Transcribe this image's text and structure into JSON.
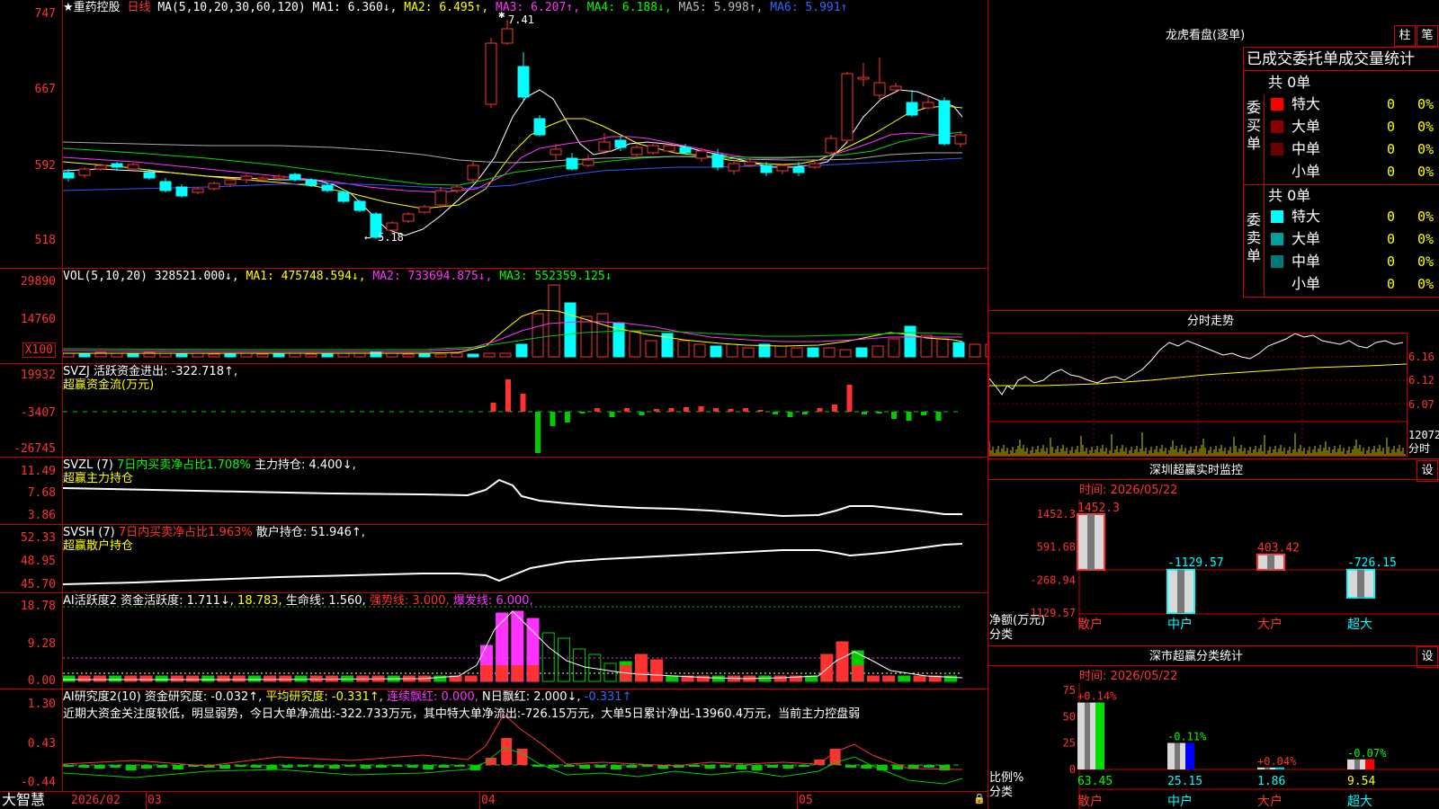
{
  "app": {
    "brand": "大智慧",
    "stock_name": "★重药控股",
    "period": "日线"
  },
  "colors": {
    "up": "#ff3232",
    "down": "#00ffff",
    "bg": "#000000",
    "frame": "#c00000"
  },
  "kline": {
    "ma_label": "MA(5,10,20,30,60,120)",
    "ma1": "MA1: 6.360↓,",
    "ma2": "MA2: 6.495↑,",
    "ma3": "MA3: 6.207↑,",
    "ma4": "MA4: 6.188↓,",
    "ma5": "MA5: 5.998↑,",
    "ma6": "MA6: 5.991↑",
    "yticks": [
      "747",
      "667",
      "592",
      "518"
    ],
    "high_mark": "7.41",
    "low_mark": "5.18"
  },
  "vol": {
    "label": "VOL(5,10,20)",
    "value": "328521.000↓,",
    "ma1": "MA1: 475748.594↓,",
    "ma2": "MA2: 733694.875↓,",
    "ma3": "MA3: 552359.125↓",
    "yticks": [
      "29890",
      "14760"
    ],
    "unit": "X100"
  },
  "svzj": {
    "label": "SVZJ  活跃资金进出: -322.718↑,",
    "subtitle": "超赢资金流(万元)",
    "yticks": [
      "19932",
      "-3407",
      "-26745"
    ]
  },
  "svzl": {
    "label": "SVZL (7)",
    "ratio": "7日内买卖净占比1.708%",
    "pos": "主力持仓: 4.400↓,",
    "subtitle": "超赢主力持仓",
    "yticks": [
      "11.49",
      "7.68",
      "3.86"
    ]
  },
  "svsh": {
    "label": "SVSH (7)",
    "ratio": "7日内买卖净占比1.963%",
    "pos": "散户持仓: 51.946↑,",
    "subtitle": "超赢散户持仓",
    "yticks": [
      "52.33",
      "48.95",
      "45.70"
    ]
  },
  "ai1": {
    "label": "AI活跃度2",
    "a": "资金活跃度: 1.711↓,",
    "b": "18.783,",
    "c": "生命线: 1.560,",
    "d": "强势线: 3.000,",
    "e": "爆发线: 6.000,",
    "yticks": [
      "18.78",
      "9.28",
      "0.00"
    ]
  },
  "ai2": {
    "label": "AI研究度2(10)",
    "a": "资金研究度: -0.032↑,",
    "b": "平均研究度: -0.331↑,",
    "c": "连续飘红: 0.000,",
    "d": "N日飘红: 2.000↓,",
    "e": "-0.331↑",
    "text": "近期大资金关注度较低，明显弱势，今日大单净流出:-322.733万元，其中特大单净流出:-726.15万元，大单5日累计净出-13960.4万元，当前主力控盘弱",
    "yticks": [
      "1.30",
      "0.43",
      "-0.44"
    ]
  },
  "xaxis": {
    "labels": [
      "2026/02",
      "03",
      "04",
      "05"
    ]
  },
  "lhb": {
    "title": "龙虎看盘(逐单)",
    "btn1": "柱",
    "btn2": "笔",
    "header": "已成交委托单成交量统计",
    "buy_label": "委买单",
    "sell_label": "委卖单",
    "buy_total": "共 0单",
    "sell_total": "共 0单",
    "buy_rows": [
      {
        "name": "特大",
        "count": "0",
        "pct": "0%",
        "color": "#ff0000"
      },
      {
        "name": "大单",
        "count": "0",
        "pct": "0%",
        "color": "#8b0000"
      },
      {
        "name": "中单",
        "count": "0",
        "pct": "0%",
        "color": "#6e0000"
      },
      {
        "name": "小单",
        "count": "0",
        "pct": "0%",
        "color": "#000000"
      }
    ],
    "sell_rows": [
      {
        "name": "特大",
        "count": "0",
        "pct": "0%",
        "color": "#00ffff"
      },
      {
        "name": "大单",
        "count": "0",
        "pct": "0%",
        "color": "#00a0a0"
      },
      {
        "name": "中单",
        "count": "0",
        "pct": "0%",
        "color": "#007878"
      },
      {
        "name": "小单",
        "count": "0",
        "pct": "0%",
        "color": "#000000"
      }
    ]
  },
  "intraday": {
    "title": "分时走势",
    "yticks": [
      "6.16",
      "6.12",
      "6.07"
    ],
    "vol_tick": "12072",
    "vol_label": "分时"
  },
  "sz_monitor": {
    "title": "深圳超赢实时监控",
    "btn": "设",
    "time": "时间: 2026/05/22",
    "yticks": [
      "1452.3",
      "591.68",
      "-268.94",
      "-1129.57"
    ],
    "side_label1": "净额(万元)",
    "side_label2": "分类",
    "bars": [
      {
        "name": "散户",
        "value": 1452.3,
        "label": "1452.3"
      },
      {
        "name": "中户",
        "value": -1129.57,
        "label": "-1129.57"
      },
      {
        "name": "大户",
        "value": 403.42,
        "label": "403.42"
      },
      {
        "name": "超大",
        "value": -726.15,
        "label": "-726.15"
      }
    ]
  },
  "sz_class": {
    "title": "深市超赢分类统计",
    "btn": "设",
    "time": "时间: 2026/05/22",
    "yticks": [
      "75",
      "50",
      "25",
      "0"
    ],
    "side_label1": "比例%",
    "side_label2": "分类",
    "bars": [
      {
        "name": "散户",
        "value": 63.45,
        "label": "63.45",
        "chg": "+0.14%"
      },
      {
        "name": "中户",
        "value": 25.15,
        "label": "25.15",
        "chg": "-0.11%"
      },
      {
        "name": "大户",
        "value": 1.86,
        "label": "1.86",
        "chg": "+0.04%"
      },
      {
        "name": "超大",
        "value": 9.54,
        "label": "9.54",
        "chg": "-0.07%"
      }
    ]
  }
}
